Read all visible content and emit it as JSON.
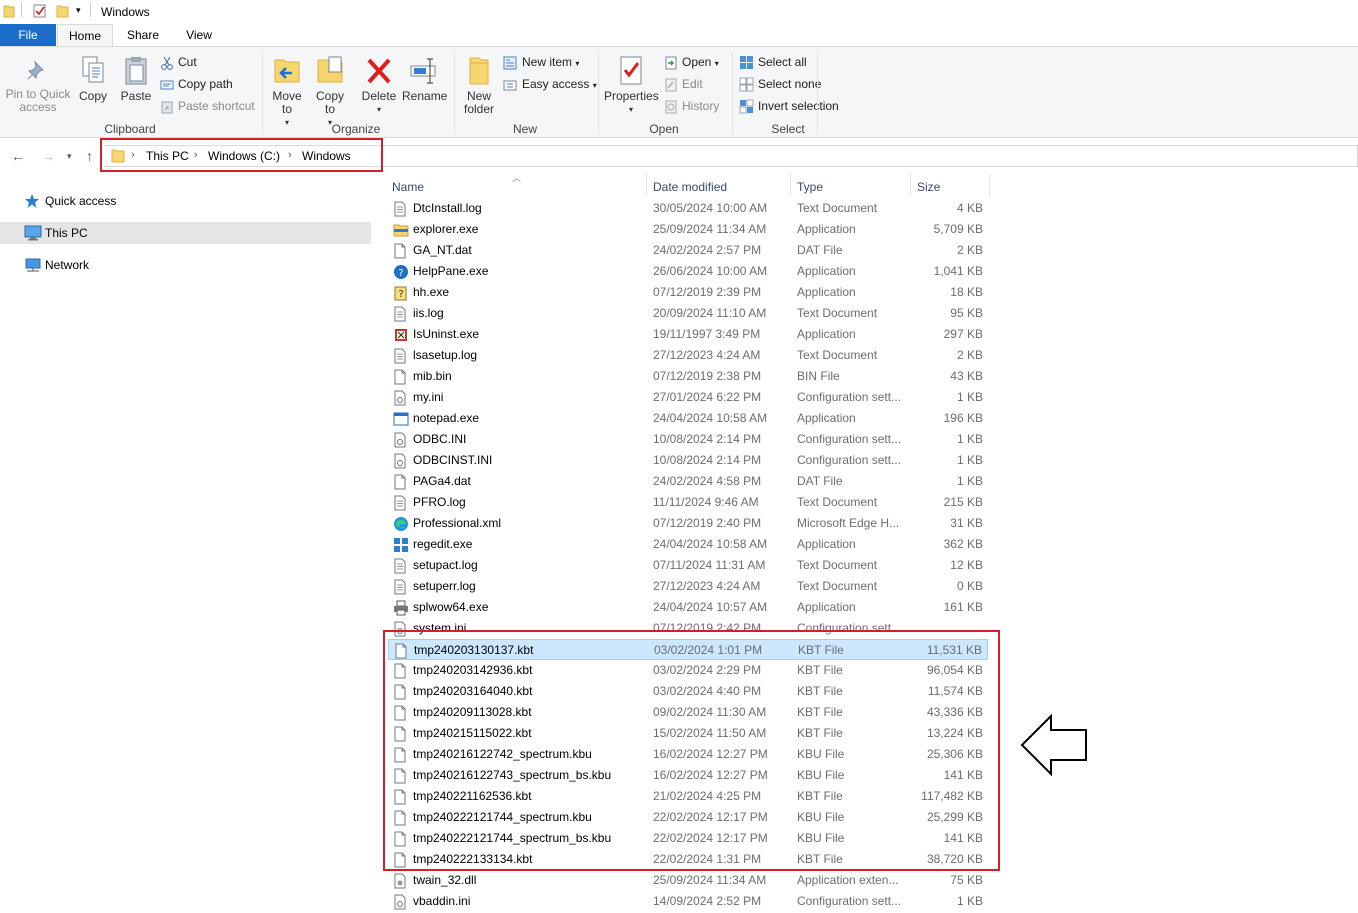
{
  "window": {
    "title": "Windows"
  },
  "tabs": [
    {
      "id": "file",
      "label": "File"
    },
    {
      "id": "home",
      "label": "Home"
    },
    {
      "id": "share",
      "label": "Share"
    },
    {
      "id": "view",
      "label": "View"
    }
  ],
  "ribbon": {
    "clipboard": {
      "label": "Clipboard",
      "pin_label": "Pin to Quick access",
      "copy_label": "Copy",
      "paste_label": "Paste",
      "cut_label": "Cut",
      "copy_path_label": "Copy path",
      "paste_shortcut_label": "Paste shortcut"
    },
    "organize": {
      "label": "Organize",
      "move_to_label": "Move to",
      "copy_to_label": "Copy to",
      "delete_label": "Delete",
      "rename_label": "Rename"
    },
    "new": {
      "label": "New",
      "new_folder_label": "New folder",
      "new_item_label": "New item",
      "easy_access_label": "Easy access"
    },
    "open": {
      "label": "Open",
      "properties_label": "Properties",
      "open_label": "Open",
      "edit_label": "Edit",
      "history_label": "History"
    },
    "select": {
      "label": "Select",
      "select_all_label": "Select all",
      "select_none_label": "Select none",
      "invert_selection_label": "Invert selection"
    }
  },
  "breadcrumb": [
    "This PC",
    "Windows (C:)",
    "Windows"
  ],
  "nav_pane": [
    {
      "label": "Quick access",
      "icon": "star-icon"
    },
    {
      "label": "This PC",
      "icon": "computer-icon",
      "selected": true
    },
    {
      "label": "Network",
      "icon": "network-icon"
    }
  ],
  "columns": {
    "name": "Name",
    "date": "Date modified",
    "type": "Type",
    "size": "Size"
  },
  "files": [
    {
      "name": "DtcInstall.log",
      "date": "30/05/2024 10:00 AM",
      "type": "Text Document",
      "size": "4 KB",
      "icon": "doc"
    },
    {
      "name": "explorer.exe",
      "date": "25/09/2024 11:34 AM",
      "type": "Application",
      "size": "5,709 KB",
      "icon": "explorer"
    },
    {
      "name": "GA_NT.dat",
      "date": "24/02/2024 2:57 PM",
      "type": "DAT File",
      "size": "2 KB",
      "icon": "blank"
    },
    {
      "name": "HelpPane.exe",
      "date": "26/06/2024 10:00 AM",
      "type": "Application",
      "size": "1,041 KB",
      "icon": "help"
    },
    {
      "name": "hh.exe",
      "date": "07/12/2019 2:39 PM",
      "type": "Application",
      "size": "18 KB",
      "icon": "hh"
    },
    {
      "name": "iis.log",
      "date": "20/09/2024 11:10 AM",
      "type": "Text Document",
      "size": "95 KB",
      "icon": "doc"
    },
    {
      "name": "IsUninst.exe",
      "date": "19/11/1997 3:49 PM",
      "type": "Application",
      "size": "297 KB",
      "icon": "uninst"
    },
    {
      "name": "lsasetup.log",
      "date": "27/12/2023 4:24 AM",
      "type": "Text Document",
      "size": "2 KB",
      "icon": "doc"
    },
    {
      "name": "mib.bin",
      "date": "07/12/2019 2:38 PM",
      "type": "BIN File",
      "size": "43 KB",
      "icon": "blank"
    },
    {
      "name": "my.ini",
      "date": "27/01/2024 6:22 PM",
      "type": "Configuration sett...",
      "size": "1 KB",
      "icon": "ini"
    },
    {
      "name": "notepad.exe",
      "date": "24/04/2024 10:58 AM",
      "type": "Application",
      "size": "196 KB",
      "icon": "app"
    },
    {
      "name": "ODBC.INI",
      "date": "10/08/2024 2:14 PM",
      "type": "Configuration sett...",
      "size": "1 KB",
      "icon": "ini"
    },
    {
      "name": "ODBCINST.INI",
      "date": "10/08/2024 2:14 PM",
      "type": "Configuration sett...",
      "size": "1 KB",
      "icon": "ini"
    },
    {
      "name": "PAGa4.dat",
      "date": "24/02/2024 4:58 PM",
      "type": "DAT File",
      "size": "1 KB",
      "icon": "blank"
    },
    {
      "name": "PFRO.log",
      "date": "11/11/2024 9:46 AM",
      "type": "Text Document",
      "size": "215 KB",
      "icon": "doc"
    },
    {
      "name": "Professional.xml",
      "date": "07/12/2019 2:40 PM",
      "type": "Microsoft Edge H...",
      "size": "31 KB",
      "icon": "edge"
    },
    {
      "name": "regedit.exe",
      "date": "24/04/2024 10:58 AM",
      "type": "Application",
      "size": "362 KB",
      "icon": "regedit"
    },
    {
      "name": "setupact.log",
      "date": "07/11/2024 11:31 AM",
      "type": "Text Document",
      "size": "12 KB",
      "icon": "doc"
    },
    {
      "name": "setuperr.log",
      "date": "27/12/2023 4:24 AM",
      "type": "Text Document",
      "size": "0 KB",
      "icon": "doc"
    },
    {
      "name": "splwow64.exe",
      "date": "24/04/2024 10:57 AM",
      "type": "Application",
      "size": "161 KB",
      "icon": "printer"
    },
    {
      "name": "system.ini",
      "date": "07/12/2019 2:42 PM",
      "type": "Configuration sett...",
      "size": "",
      "icon": "ini"
    },
    {
      "name": "tmp240203130137.kbt",
      "date": "03/02/2024 1:01 PM",
      "type": "KBT File",
      "size": "11,531 KB",
      "icon": "blank",
      "selected": true
    },
    {
      "name": "tmp240203142936.kbt",
      "date": "03/02/2024 2:29 PM",
      "type": "KBT File",
      "size": "96,054 KB",
      "icon": "blank"
    },
    {
      "name": "tmp240203164040.kbt",
      "date": "03/02/2024 4:40 PM",
      "type": "KBT File",
      "size": "11,574 KB",
      "icon": "blank"
    },
    {
      "name": "tmp240209113028.kbt",
      "date": "09/02/2024 11:30 AM",
      "type": "KBT File",
      "size": "43,336 KB",
      "icon": "blank"
    },
    {
      "name": "tmp240215115022.kbt",
      "date": "15/02/2024 11:50 AM",
      "type": "KBT File",
      "size": "13,224 KB",
      "icon": "blank"
    },
    {
      "name": "tmp240216122742_spectrum.kbu",
      "date": "16/02/2024 12:27 PM",
      "type": "KBU File",
      "size": "25,306 KB",
      "icon": "blank"
    },
    {
      "name": "tmp240216122743_spectrum_bs.kbu",
      "date": "16/02/2024 12:27 PM",
      "type": "KBU File",
      "size": "141 KB",
      "icon": "blank"
    },
    {
      "name": "tmp240221162536.kbt",
      "date": "21/02/2024 4:25 PM",
      "type": "KBT File",
      "size": "117,482 KB",
      "icon": "blank"
    },
    {
      "name": "tmp240222121744_spectrum.kbu",
      "date": "22/02/2024 12:17 PM",
      "type": "KBU File",
      "size": "25,299 KB",
      "icon": "blank"
    },
    {
      "name": "tmp240222121744_spectrum_bs.kbu",
      "date": "22/02/2024 12:17 PM",
      "type": "KBU File",
      "size": "141 KB",
      "icon": "blank"
    },
    {
      "name": "tmp240222133134.kbt",
      "date": "22/02/2024 1:31 PM",
      "type": "KBT File",
      "size": "38,720 KB",
      "icon": "blank"
    },
    {
      "name": "twain_32.dll",
      "date": "25/09/2024 11:34 AM",
      "type": "Application exten...",
      "size": "75 KB",
      "icon": "dll"
    },
    {
      "name": "vbaddin.ini",
      "date": "14/09/2024 2:52 PM",
      "type": "Configuration sett...",
      "size": "1 KB",
      "icon": "ini"
    }
  ],
  "colors": {
    "accent": "#1a6ec9",
    "highlight": "#d21f2b",
    "selection": "#cce8ff"
  }
}
